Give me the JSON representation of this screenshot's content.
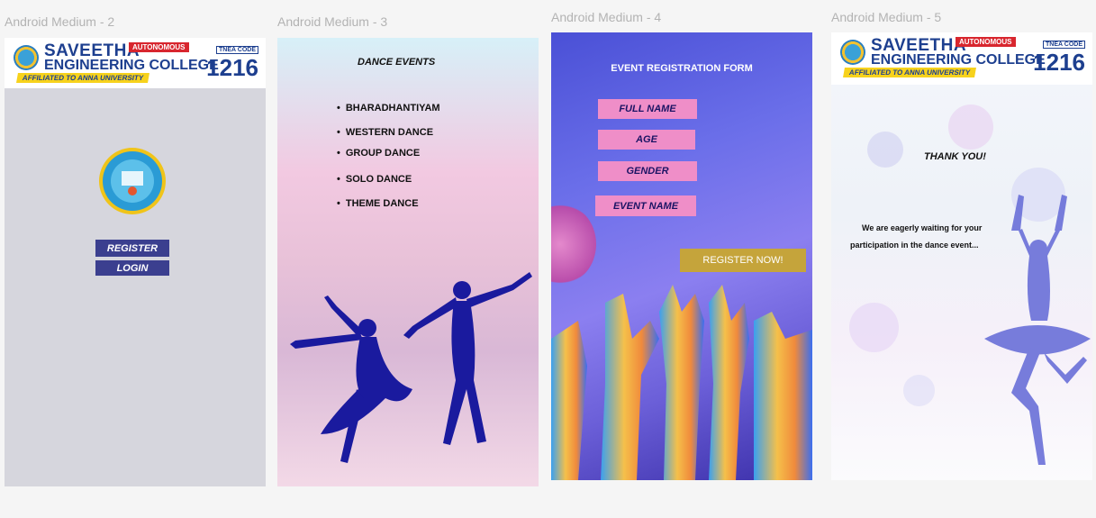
{
  "frames": [
    {
      "label": "Android Medium - 2"
    },
    {
      "label": "Android Medium - 3"
    },
    {
      "label": "Android Medium - 4"
    },
    {
      "label": "Android Medium - 5"
    }
  ],
  "banner": {
    "name_line1": "SAVEETHA",
    "name_line2": "ENGINEERING COLLEGE",
    "autonomous": "AUTONOMOUS",
    "affiliated": "AFFILIATED TO ANNA UNIVERSITY",
    "tnea_label": "TNEA CODE",
    "tnea_code": "1216"
  },
  "screen2": {
    "register_label": "REGISTER",
    "login_label": "LOGIN",
    "bg_color": "#d6d6dd",
    "button_color": "#3b3f8f"
  },
  "screen3": {
    "title": "DANCE  EVENTS",
    "events": [
      "BHARADHANTIYAM",
      "WESTERN DANCE",
      "GROUP DANCE",
      "SOLO DANCE",
      "THEME DANCE"
    ]
  },
  "screen4": {
    "title": "EVENT REGISTRATION FORM",
    "fields": [
      "FULL NAME",
      "AGE",
      "GENDER",
      "EVENT NAME"
    ],
    "submit_label": "REGISTER NOW!",
    "field_color": "#ef8ec8",
    "submit_color": "#c5a43b"
  },
  "screen5": {
    "heading": "THANK YOU!",
    "message_line1": "We are eagerly waiting for your",
    "message_line2": "participation in the dance event..."
  }
}
